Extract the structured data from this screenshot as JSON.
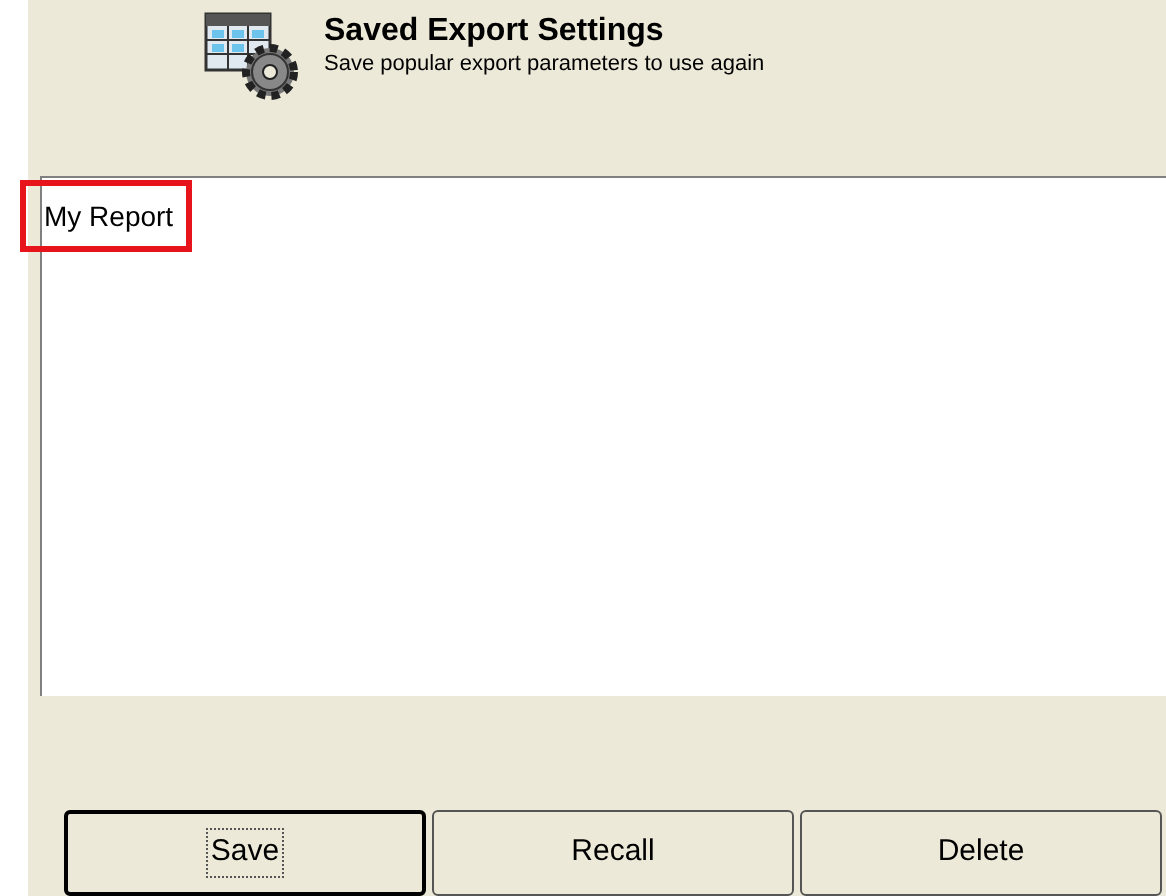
{
  "header": {
    "title": "Saved Export Settings",
    "subtitle": "Save popular export parameters to use again"
  },
  "list": {
    "items": [
      {
        "label": "My Report",
        "highlighted": true
      }
    ]
  },
  "buttons": [
    {
      "label": "Save",
      "default": true
    },
    {
      "label": "Recall",
      "default": false
    },
    {
      "label": "Delete",
      "default": false
    }
  ]
}
